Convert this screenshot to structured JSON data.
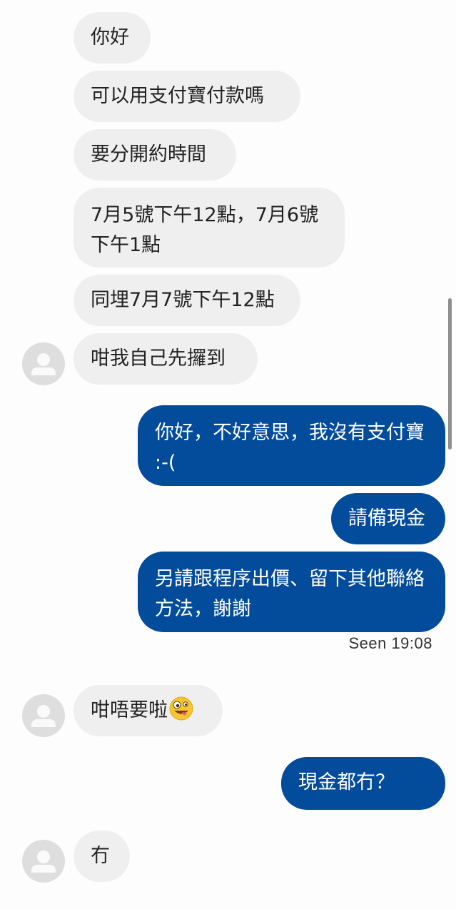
{
  "messages": [
    {
      "dir": "in",
      "text": "你好"
    },
    {
      "dir": "in",
      "text": "可以用支付寶付款嗎"
    },
    {
      "dir": "in",
      "text": "要分開約時間"
    },
    {
      "dir": "in",
      "text": "7月5號下午12點，7月6號下午1點"
    },
    {
      "dir": "in",
      "text": "同埋7月7號下午12點"
    },
    {
      "dir": "in",
      "text": "咁我自己先攞到"
    },
    {
      "dir": "out",
      "text": "你好，不好意思，我沒有支付寶 :-("
    },
    {
      "dir": "out",
      "text": "請備現金"
    },
    {
      "dir": "out",
      "text": "另請跟程序出價、留下其他聯絡方法，謝謝"
    },
    {
      "dir": "in",
      "text": "咁唔要啦"
    },
    {
      "dir": "out",
      "text": "現金都冇？"
    },
    {
      "dir": "in",
      "text": "冇"
    }
  ],
  "emoji": {
    "name": "zany-face-emoji"
  },
  "seen": "Seen 19:08",
  "colors": {
    "incoming_bubble": "#efefef",
    "outgoing_bubble": "#034b9b",
    "avatar": "#dedede"
  }
}
